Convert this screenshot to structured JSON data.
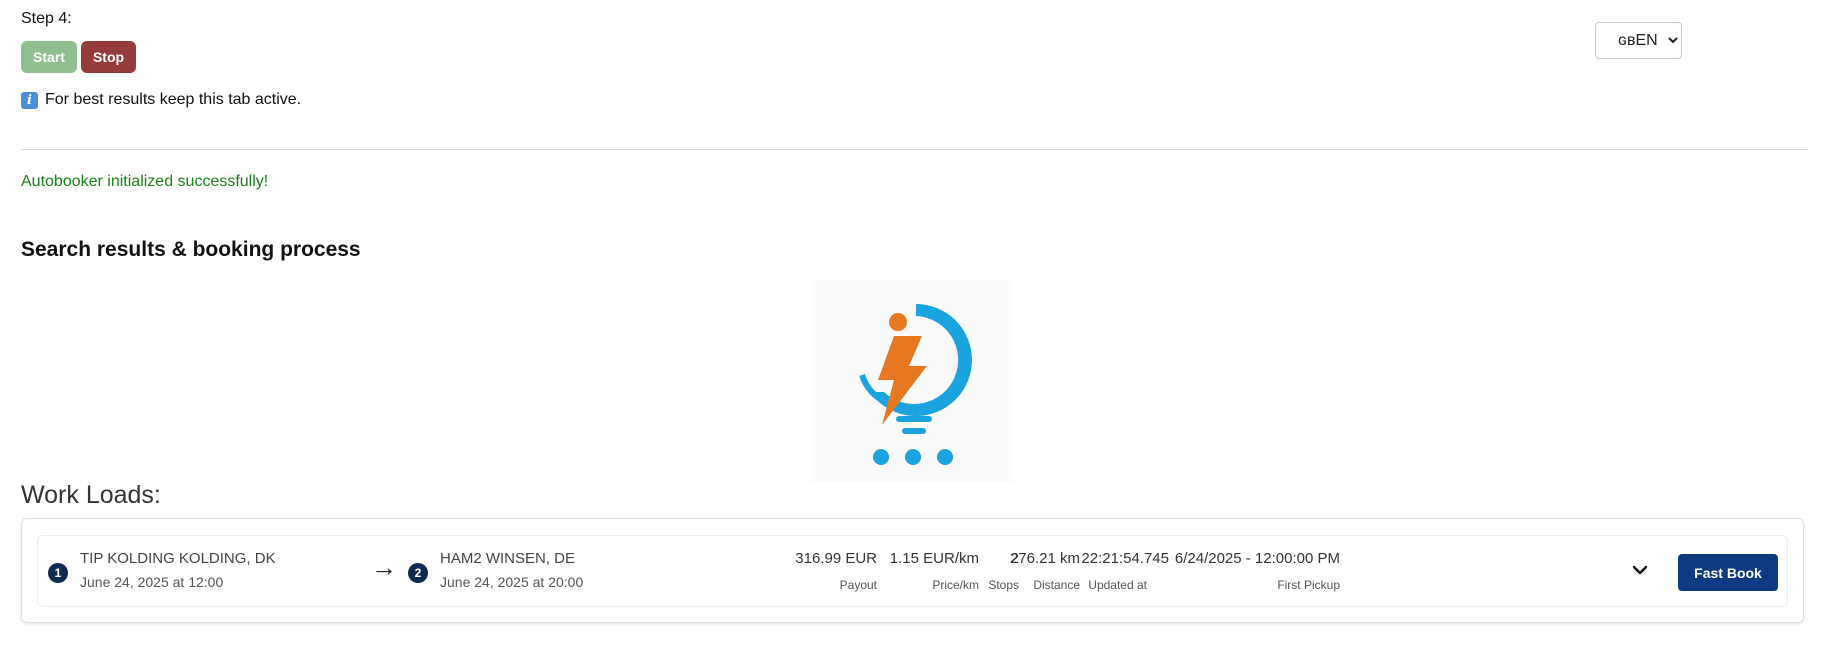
{
  "controls": {
    "step_label": "Step 4:",
    "start_label": "Start",
    "stop_label": "Stop",
    "start_color": "#8fbf8f",
    "stop_color": "#953b3b"
  },
  "language": {
    "selected": "ɢʙEN",
    "options": [
      "ɢʙEN"
    ]
  },
  "tip": {
    "icon": "info-icon",
    "text": "For best results keep this tab active."
  },
  "status": {
    "message": "Autobooker initialized successfully!",
    "color": "#1a7e1a"
  },
  "section": {
    "title": "Search results & booking process"
  },
  "loader": {
    "icon": "lightning-bulb-loader-icon",
    "colors": {
      "orange": "#e87722",
      "blue": "#1aa3de"
    }
  },
  "work_loads": {
    "title": "Work Loads:",
    "items": [
      {
        "origin": {
          "badge": "1",
          "name": "TIP KOLDING KOLDING, DK",
          "date": "June 24, 2025 at 12:00"
        },
        "arrow": "→",
        "destination": {
          "badge": "2",
          "name": "HAM2 WINSEN, DE",
          "date": "June 24, 2025 at 20:00"
        },
        "metrics": {
          "payout": {
            "value": "316.99 EUR",
            "label": "Payout"
          },
          "price_km": {
            "value": "1.15 EUR/km",
            "label": "Price/km"
          },
          "stops": {
            "value": "2",
            "label": "Stops"
          },
          "distance": {
            "value": "276.21 km",
            "label": "Distance"
          },
          "updated": {
            "value": "22:21:54.745",
            "label": "Updated at"
          },
          "first_pickup": {
            "value": "6/24/2025 - 12:00:00 PM",
            "label": "First Pickup"
          }
        },
        "fast_book_label": "Fast Book",
        "fast_book_color": "#0d3a80"
      }
    ]
  }
}
